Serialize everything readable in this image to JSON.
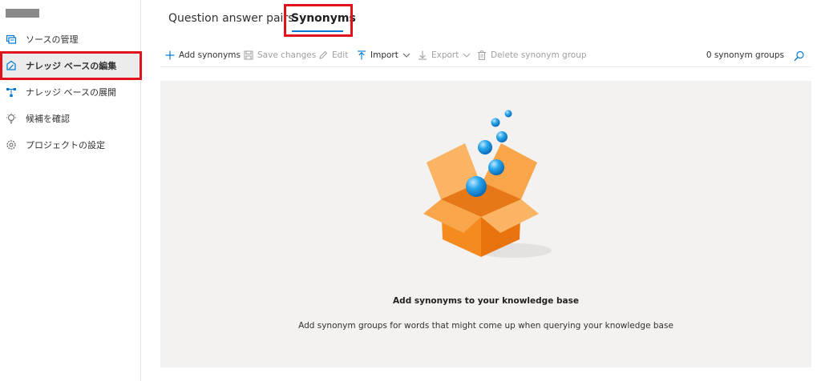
{
  "sidebar": {
    "items": [
      {
        "label": "ソースの管理",
        "icon": "manage-sources-icon"
      },
      {
        "label": "ナレッジ ベースの編集",
        "icon": "edit-knowledge-base-icon",
        "selected": true
      },
      {
        "label": "ナレッジ ベースの展開",
        "icon": "deploy-knowledge-base-icon"
      },
      {
        "label": "候補を確認",
        "icon": "review-suggestions-icon"
      },
      {
        "label": "プロジェクトの設定",
        "icon": "project-settings-icon"
      }
    ]
  },
  "tabs": [
    {
      "label": "Question answer pairs",
      "active": false
    },
    {
      "label": "Synonyms",
      "active": true
    }
  ],
  "toolbar": {
    "add": "Add synonyms",
    "save": "Save changes",
    "edit": "Edit",
    "import": "Import",
    "export": "Export",
    "delete": "Delete synonym group",
    "count": "0 synonym groups"
  },
  "empty_state": {
    "title": "Add synonyms to your knowledge base",
    "description": "Add synonym groups for words that might come up when querying your knowledge base"
  },
  "colors": {
    "accent": "#0078d4",
    "highlight": "#e0121d",
    "box": "#f7941d",
    "bubble": "#1ea0e8"
  }
}
